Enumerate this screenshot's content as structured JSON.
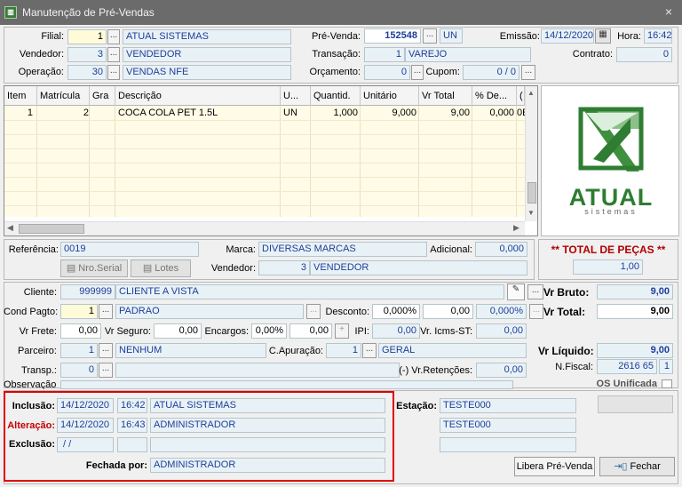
{
  "window": {
    "title": "Manutenção de Pré-Vendas",
    "close": "×"
  },
  "header": {
    "filial_label": "Filial:",
    "filial_code": "1",
    "filial_name": "ATUAL SISTEMAS",
    "vendedor_label": "Vendedor:",
    "vendedor_code": "3",
    "vendedor_name": "VENDEDOR",
    "operacao_label": "Operação:",
    "operacao_code": "30",
    "operacao_name": "VENDAS NFE",
    "prevenda_label": "Pré-Venda:",
    "prevenda_number": "152548",
    "prevenda_unit": "UN",
    "transacao_label": "Transação:",
    "transacao_code": "1",
    "transacao_name": "VAREJO",
    "orcamento_label": "Orçamento:",
    "orcamento_value": "0",
    "cupom_label": "Cupom:",
    "cupom_value": "0 / 0",
    "emissao_label": "Emissão:",
    "emissao_date": "14/12/2020",
    "hora_label": "Hora:",
    "hora_value": "16:42",
    "contrato_label": "Contrato:",
    "contrato_value": "0",
    "ellipsis": "..."
  },
  "grid": {
    "columns": [
      "Item",
      "Matrícula",
      "Gra",
      "Descrição",
      "U...",
      "Quantid.",
      "Unitário",
      "Vr Total",
      "% De...",
      "("
    ],
    "rows": [
      [
        "1",
        "2",
        "",
        "COCA COLA PET 1.5L",
        "UN",
        "1,000",
        "9,000",
        "9,00",
        "0,000",
        "0E"
      ]
    ]
  },
  "logo": {
    "brand": "ATUAL",
    "sub": "sistemas"
  },
  "product": {
    "referencia_label": "Referência:",
    "referencia_value": "0019",
    "marca_label": "Marca:",
    "marca_value": "DIVERSAS MARCAS",
    "adicional_label": "Adicional:",
    "adicional_value": "0,000",
    "nro_serial": "Nro.Serial",
    "lotes": "Lotes",
    "vendedor_label": "Vendedor:",
    "vendedor_code": "3",
    "vendedor_name": "VENDEDOR"
  },
  "pecas": {
    "title": "** TOTAL DE PEÇAS **",
    "value": "1,00"
  },
  "customer": {
    "cliente_label": "Cliente:",
    "cliente_code": "999999",
    "cliente_name": "CLIENTE A VISTA",
    "cond_label": "Cond Pagto:",
    "cond_code": "1",
    "cond_name": "PADRAO",
    "desconto_label": "Desconto:",
    "desconto_pct": "0,000%",
    "desconto_val": "0,00",
    "desconto_pct2": "0,000%",
    "frete_label": "Vr Frete:",
    "frete_value": "0,00",
    "seguro_label": "Vr Seguro:",
    "seguro_value": "0,00",
    "encargos_label": "Encargos:",
    "encargos_pct": "0,00%",
    "encargos_val": "0,00",
    "ipi_label": "IPI:",
    "ipi_value": "0,00",
    "icms_label": "Vr. Icms-ST:",
    "icms_value": "0,00",
    "parceiro_label": "Parceiro:",
    "parceiro_code": "1",
    "parceiro_name": "NENHUM",
    "capuracao_label": "C.Apuração:",
    "capuracao_code": "1",
    "capuracao_name": "GERAL",
    "transp_label": "Transp.:",
    "transp_code": "0",
    "retencoes_label": "(-) Vr.Retenções:",
    "retencoes_value": "0,00",
    "observacao_label": "Observação:"
  },
  "totals": {
    "bruto_label": "Vr Bruto:",
    "bruto_value": "9,00",
    "total_label": "Vr Total:",
    "total_value": "9,00",
    "liquido_label": "Vr Líquido:",
    "liquido_value": "9,00",
    "nfiscal_label": "N.Fiscal:",
    "nfiscal_value": "2616 65",
    "nfiscal_serie": "1",
    "os_label": "OS Unificada"
  },
  "audit": {
    "inclusao_label": "Inclusão:",
    "inclusao_date": "14/12/2020",
    "inclusao_time": "16:42",
    "inclusao_user": "ATUAL SISTEMAS",
    "alteracao_label": "Alteração:",
    "alteracao_date": "14/12/2020",
    "alteracao_time": "16:43",
    "alteracao_user": "ADMINISTRADOR",
    "exclusao_label": "Exclusão:",
    "exclusao_date": " / /",
    "fechada_label": "Fechada por:",
    "fechada_user": "ADMINISTRADOR",
    "estacao_label": "Estação:",
    "estacao_1": "TESTE000",
    "estacao_2": "TESTE000"
  },
  "actions": {
    "libera": "Libera Pré-Venda",
    "fechar": "Fechar"
  },
  "colors": {
    "highlight": "#e00000",
    "field_bg": "#e8f2f6",
    "field_text": "#1f3d9a",
    "logo_green": "#2e7d32"
  }
}
